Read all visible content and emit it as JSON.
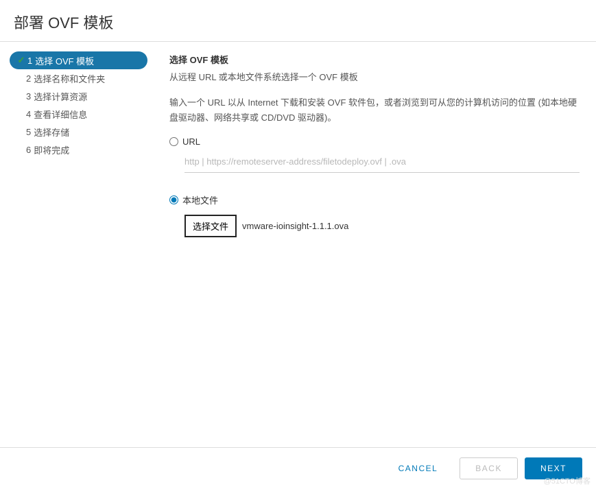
{
  "dialog": {
    "title": "部署 OVF 模板"
  },
  "wizard": {
    "steps": [
      {
        "num": "1",
        "label": "选择 OVF 模板",
        "active": true,
        "completed": true
      },
      {
        "num": "2",
        "label": "选择名称和文件夹",
        "active": false,
        "completed": false
      },
      {
        "num": "3",
        "label": "选择计算资源",
        "active": false,
        "completed": false
      },
      {
        "num": "4",
        "label": "查看详细信息",
        "active": false,
        "completed": false
      },
      {
        "num": "5",
        "label": "选择存储",
        "active": false,
        "completed": false
      },
      {
        "num": "6",
        "label": "即将完成",
        "active": false,
        "completed": false
      }
    ]
  },
  "panel": {
    "heading": "选择 OVF 模板",
    "subheading": "从远程 URL 或本地文件系统选择一个 OVF 模板",
    "instruction": "输入一个 URL 以从 Internet 下载和安装 OVF 软件包，或者浏览到可从您的计算机访问的位置 (如本地硬盘驱动器、网络共享或 CD/DVD 驱动器)。",
    "radio_url_label": "URL",
    "url_placeholder": "http | https://remoteserver-address/filetodeploy.ovf | .ova",
    "radio_local_label": "本地文件",
    "choose_file_btn": "选择文件",
    "selected_file": "vmware-ioinsight-1.1.1.ova"
  },
  "footer": {
    "cancel": "CANCEL",
    "back": "BACK",
    "next": "NEXT"
  },
  "watermark": "@51CTO博客"
}
